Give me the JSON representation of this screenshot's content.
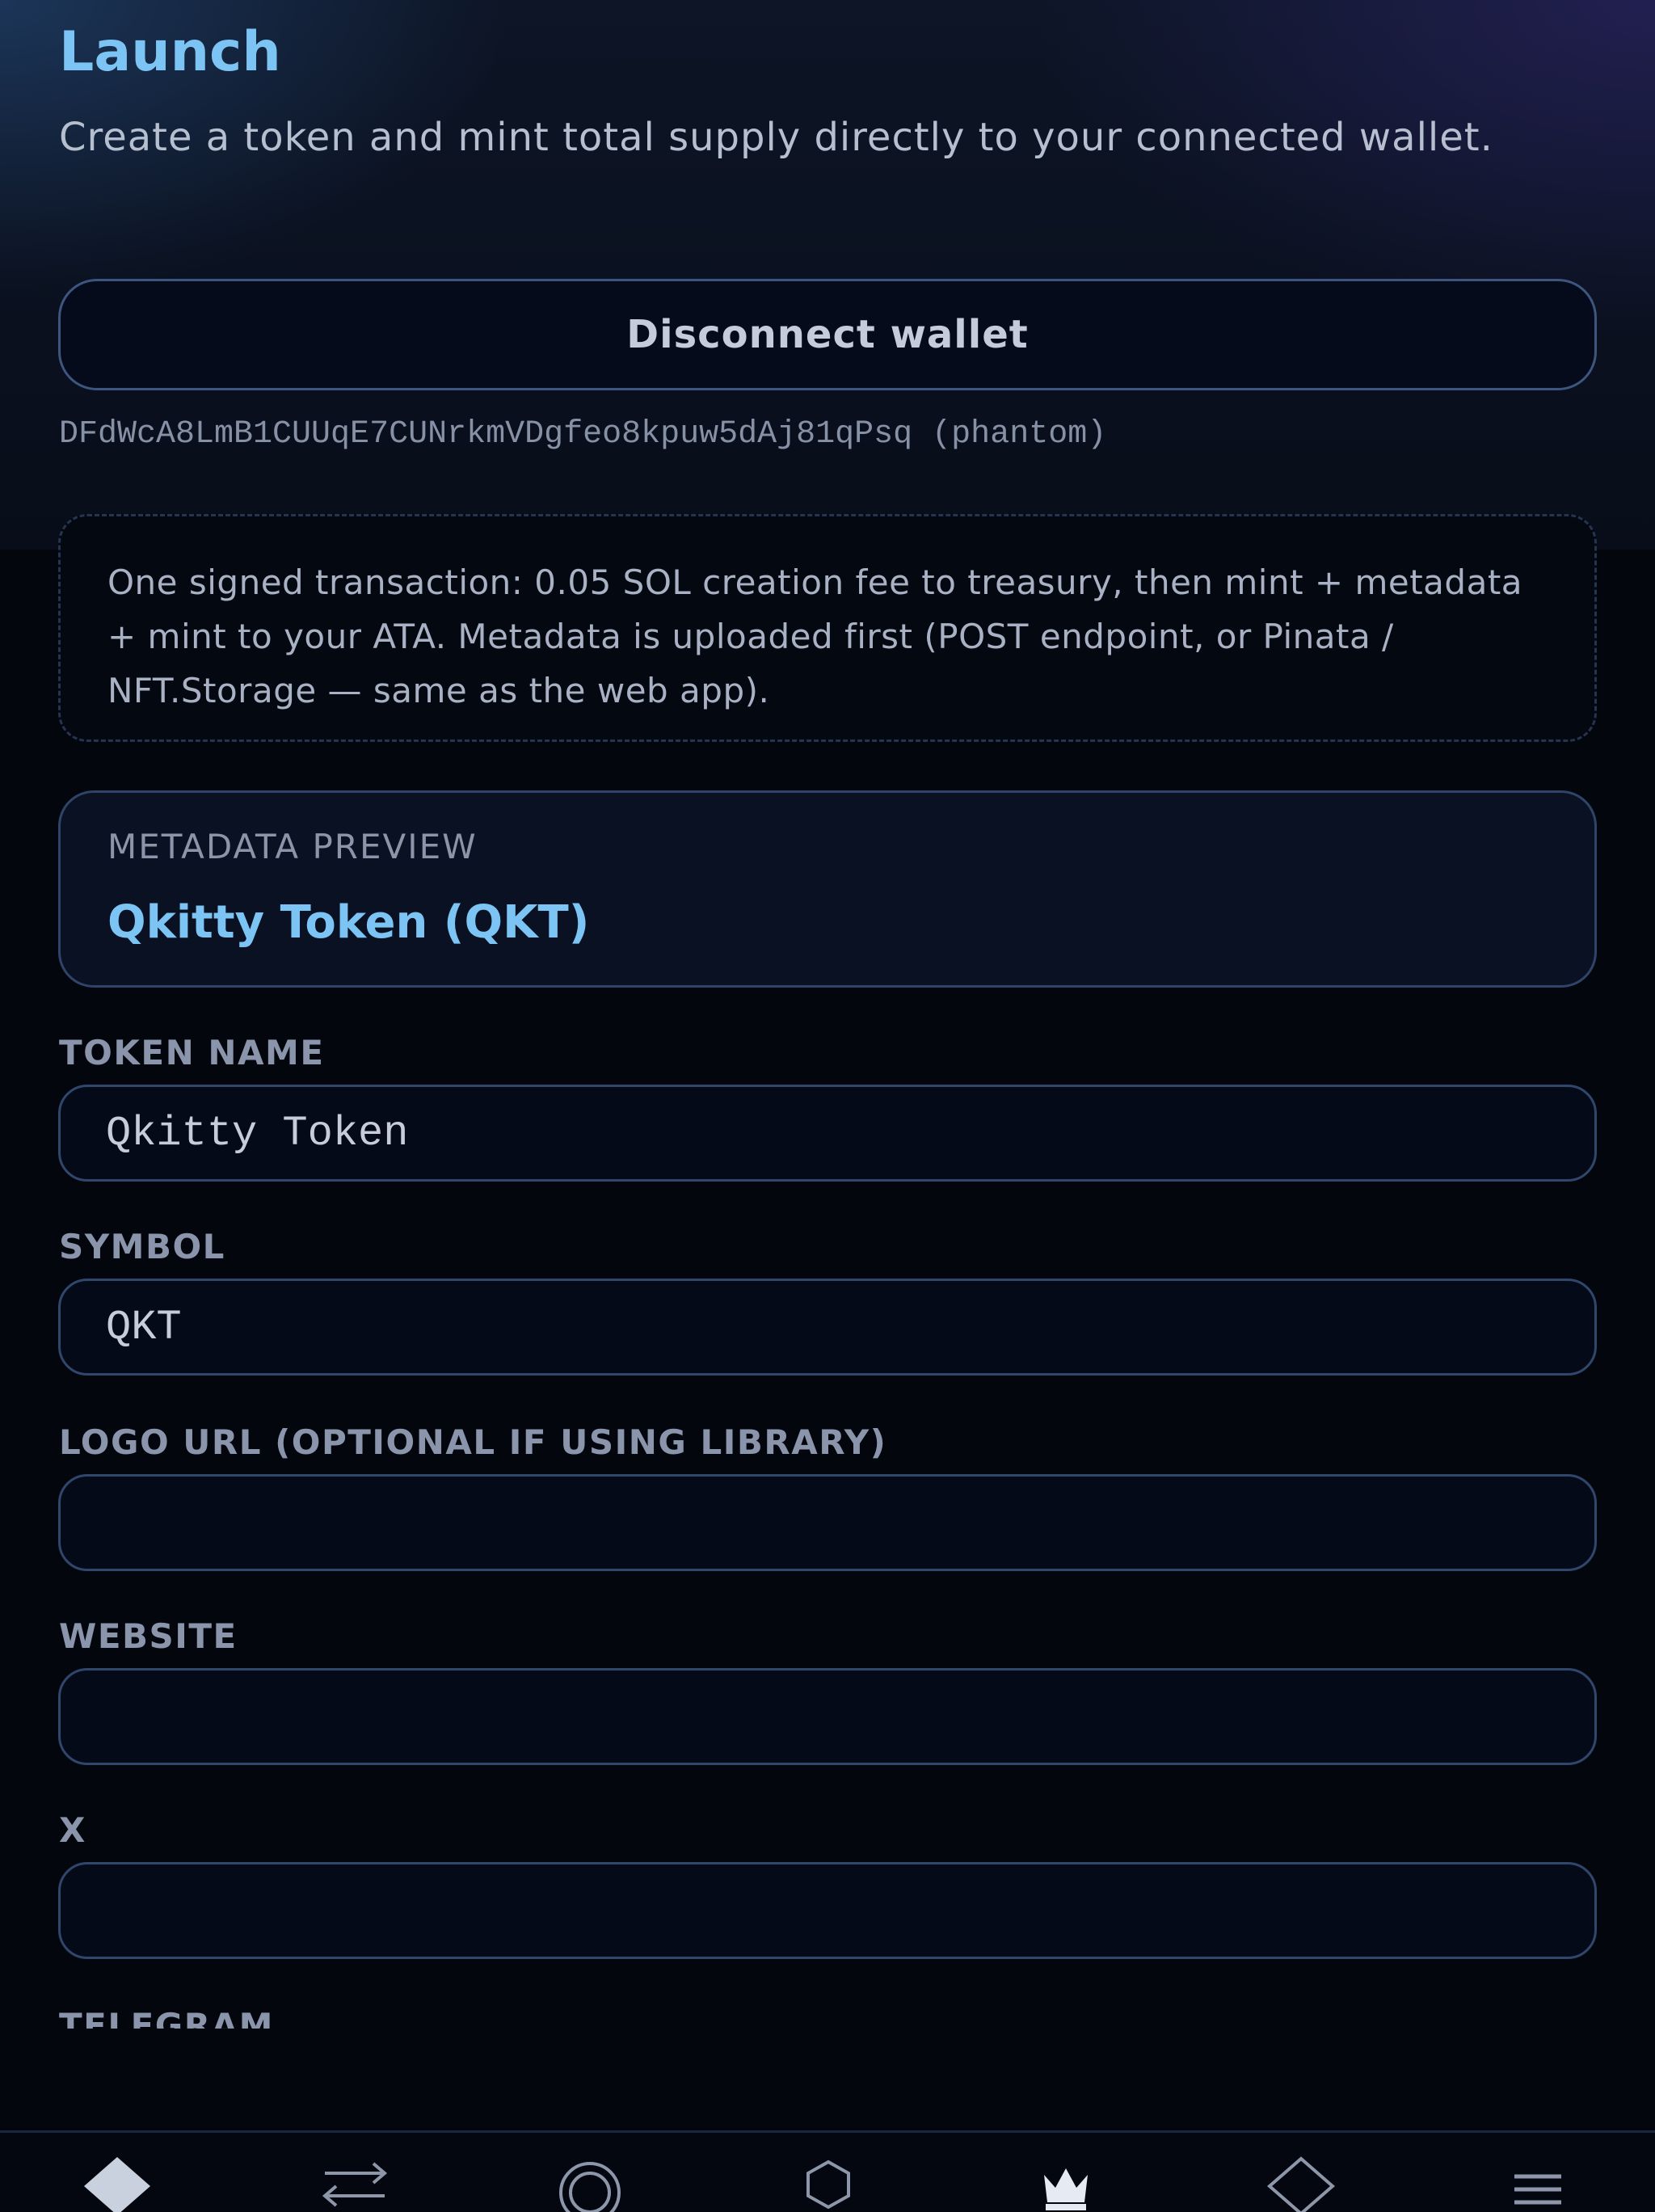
{
  "header": {
    "title": "Launch",
    "subtitle": "Create a token and mint total supply directly to your connected wallet."
  },
  "wallet": {
    "button_label": "Disconnect wallet",
    "address": "DFdWcA8LmB1CUUqE7CUNrkmVDgfeo8kpuw5dAj81qPsq (phantom)"
  },
  "notice": {
    "text": "One signed transaction: 0.05 SOL creation fee to treasury, then mint + metadata + mint to your ATA. Metadata is uploaded first (POST endpoint, or Pinata / NFT.Storage — same as the web app)."
  },
  "preview": {
    "label": "METADATA PREVIEW",
    "value": "Qkitty Token (QKT)"
  },
  "form": {
    "token_name": {
      "label": "TOKEN NAME",
      "value": "Qkitty Token"
    },
    "symbol": {
      "label": "SYMBOL",
      "value": "QKT"
    },
    "logo_url": {
      "label": "LOGO URL (OPTIONAL IF USING LIBRARY)",
      "value": ""
    },
    "website": {
      "label": "WEBSITE",
      "value": ""
    },
    "x": {
      "label": "X",
      "value": ""
    },
    "telegram": {
      "label": "TELEGRAM"
    }
  },
  "nav": {
    "items": [
      {
        "icon": "diamond-filled-icon",
        "active": true
      },
      {
        "icon": "swap-arrows-icon"
      },
      {
        "icon": "concentric-circles-icon"
      },
      {
        "icon": "hexagon-icon"
      },
      {
        "icon": "crown-icon"
      },
      {
        "icon": "diamond-outline-icon"
      },
      {
        "icon": "menu-lines-icon"
      }
    ]
  },
  "colors": {
    "accent": "#7cc4f4",
    "background": "#03060c",
    "border": "#30466b"
  }
}
